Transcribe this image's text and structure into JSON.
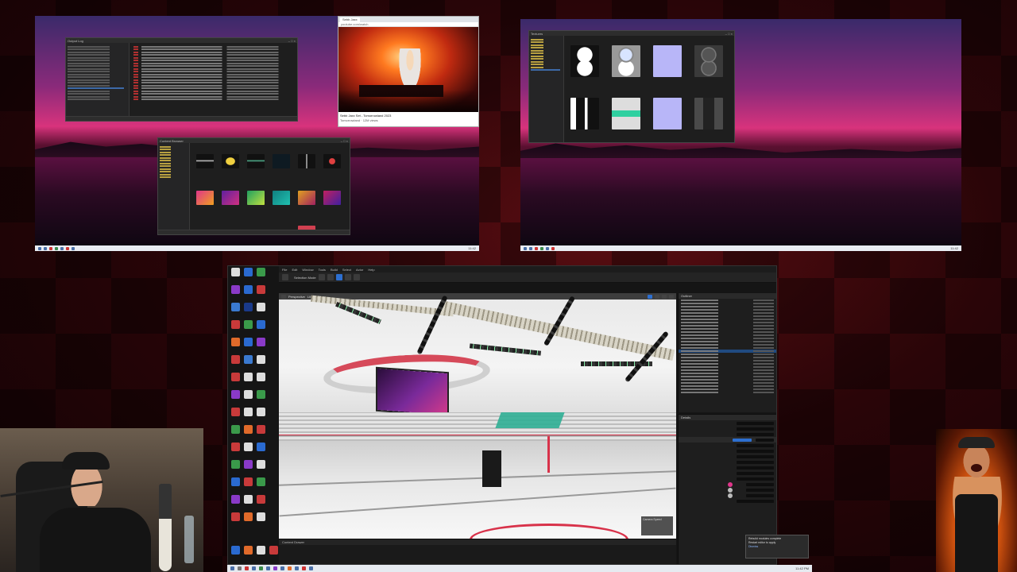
{
  "layout_desc": "multi-monitor stream capture",
  "monitor1": {
    "explorer_window": {
      "title": "Output Log"
    },
    "browser": {
      "tab": "Sebb Jaxx",
      "address": "youtube.com/watch",
      "video_title": "Sebb Jaxx Set - Tomorrowland 2023",
      "channel": "Tomorrowland",
      "views": "12M views"
    },
    "asset_browser": {
      "title": "Content Browser"
    },
    "taskbar_time": "11:42"
  },
  "monitor2": {
    "texture_window": {
      "title": "Textures"
    },
    "taskbar_time": "11:42"
  },
  "editor": {
    "menu": [
      "File",
      "Edit",
      "Window",
      "Tools",
      "Build",
      "Select",
      "Actor",
      "Help"
    ],
    "toolbar_label": "Selection Mode",
    "viewport_label": "Perspective",
    "viewport_lit": "Lit",
    "outliner_title": "Outliner",
    "details_title": "Details",
    "content_drawer": "Content Drawer",
    "camera_readout": "Camera Speed"
  },
  "notification": {
    "line1": "Rebuild modules complete",
    "line2": "Restart editor to apply",
    "button": "Dismiss"
  },
  "main_taskbar": {
    "time": "11:42 PM"
  }
}
